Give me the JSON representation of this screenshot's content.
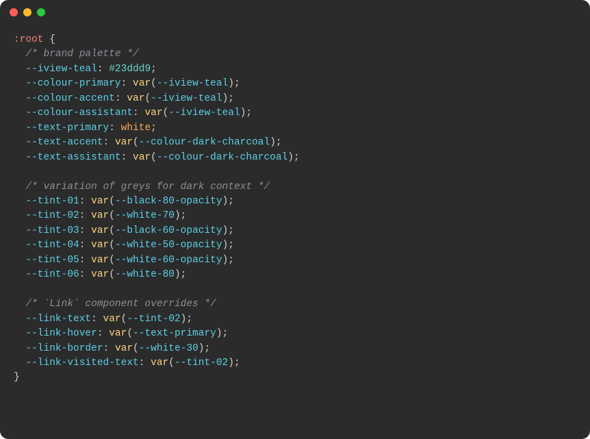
{
  "selector": ":root",
  "brace_open": "{",
  "brace_close": "}",
  "sections": [
    {
      "comment": "/* brand palette */",
      "decls": [
        {
          "prop": "--iview-teal",
          "type": "hex",
          "value": "#23ddd9"
        },
        {
          "prop": "--colour-primary",
          "type": "var",
          "ref": "--iview-teal"
        },
        {
          "prop": "--colour-accent",
          "type": "var",
          "ref": "--iview-teal"
        },
        {
          "prop": "--colour-assistant",
          "type": "var",
          "ref": "--iview-teal"
        },
        {
          "prop": "--text-primary",
          "type": "kw",
          "value": "white"
        },
        {
          "prop": "--text-accent",
          "type": "var",
          "ref": "--colour-dark-charcoal"
        },
        {
          "prop": "--text-assistant",
          "type": "var",
          "ref": "--colour-dark-charcoal"
        }
      ]
    },
    {
      "comment": "/* variation of greys for dark context */",
      "decls": [
        {
          "prop": "--tint-01",
          "type": "var",
          "ref": "--black-80-opacity"
        },
        {
          "prop": "--tint-02",
          "type": "var",
          "ref": "--white-70"
        },
        {
          "prop": "--tint-03",
          "type": "var",
          "ref": "--black-60-opacity"
        },
        {
          "prop": "--tint-04",
          "type": "var",
          "ref": "--white-50-opacity"
        },
        {
          "prop": "--tint-05",
          "type": "var",
          "ref": "--white-60-opacity"
        },
        {
          "prop": "--tint-06",
          "type": "var",
          "ref": "--white-80"
        }
      ]
    },
    {
      "comment": "/* `Link` component overrides */",
      "decls": [
        {
          "prop": "--link-text",
          "type": "var",
          "ref": "--tint-02"
        },
        {
          "prop": "--link-hover",
          "type": "var",
          "ref": "--text-primary"
        },
        {
          "prop": "--link-border",
          "type": "var",
          "ref": "--white-30"
        },
        {
          "prop": "--link-visited-text",
          "type": "var",
          "ref": "--tint-02"
        }
      ]
    }
  ]
}
